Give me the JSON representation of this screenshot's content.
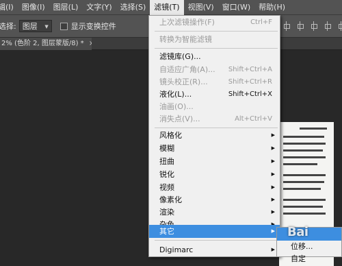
{
  "menubar": {
    "items": [
      "辑(I)",
      "图像(I)",
      "图层(L)",
      "文字(Y)",
      "选择(S)",
      "滤镜(T)",
      "视图(V)",
      "窗口(W)",
      "帮助(H)"
    ],
    "active_index": 5
  },
  "options": {
    "select_label": "选择:",
    "select_value": "图层",
    "checkbox_label": "显示变换控件"
  },
  "tab": {
    "title": "2% (色阶 2, 图层蒙版/8) *",
    "close": "×"
  },
  "filter_menu": {
    "last_filter": {
      "label": "上次滤镜操作(F)",
      "shortcut": "Ctrl+F"
    },
    "smart_filter": {
      "label": "转换为智能滤镜"
    },
    "gallery": {
      "label": "滤镜库(G)..."
    },
    "adaptive_wide": {
      "label": "自适应广角(A)...",
      "shortcut": "Shift+Ctrl+A"
    },
    "lens_correction": {
      "label": "镜头校正(R)...",
      "shortcut": "Shift+Ctrl+R"
    },
    "liquify": {
      "label": "液化(L)...",
      "shortcut": "Shift+Ctrl+X"
    },
    "oil_paint": {
      "label": "油画(O)..."
    },
    "vanishing_point": {
      "label": "消失点(V)...",
      "shortcut": "Alt+Ctrl+V"
    },
    "submenus": [
      "风格化",
      "模糊",
      "扭曲",
      "锐化",
      "视频",
      "像素化",
      "渲染",
      "杂色",
      "其它"
    ],
    "digimarc": {
      "label": "Digimarc"
    }
  },
  "other_submenu": {
    "items": [
      "位移...",
      "自定"
    ]
  },
  "watermark": "Bai"
}
